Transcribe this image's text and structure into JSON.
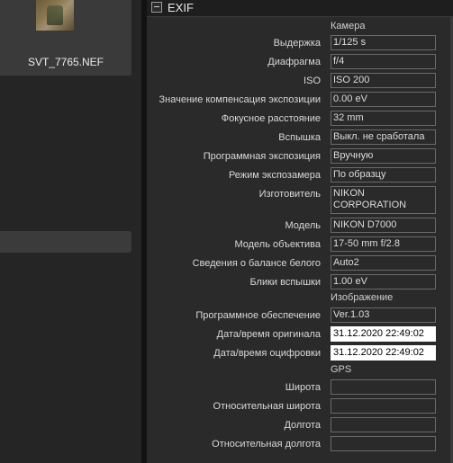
{
  "browser": {
    "thumbnail_name": "SVT_7765.NEF"
  },
  "panel": {
    "title": "EXIF",
    "sections": {
      "camera": "Камера",
      "image": "Изображение",
      "gps": "GPS"
    },
    "camera_rows": [
      {
        "label": "Выдержка",
        "value": "1/125 s"
      },
      {
        "label": "Диафрагма",
        "value": "f/4"
      },
      {
        "label": "ISO",
        "value": "ISO 200"
      },
      {
        "label": "Значение компенсация экспозиции",
        "value": "0.00 eV"
      },
      {
        "label": "Фокусное расстояние",
        "value": "32 mm"
      },
      {
        "label": "Вспышка",
        "value": "Выкл. не сработала"
      },
      {
        "label": "Программная экспозиция",
        "value": "Вручную"
      },
      {
        "label": "Режим экспозамера",
        "value": "По образцу"
      },
      {
        "label": "Изготовитель",
        "value": "NIKON\nCORPORATION"
      },
      {
        "label": "Модель",
        "value": "NIKON D7000"
      },
      {
        "label": "Модель объектива",
        "value": "17-50 mm f/2.8"
      },
      {
        "label": "Сведения о балансе белого",
        "value": "Auto2"
      },
      {
        "label": "Блики вспышки",
        "value": "1.00 eV"
      }
    ],
    "image_rows": [
      {
        "label": "Программное обеспечение",
        "value": "Ver.1.03"
      },
      {
        "label": "Дата/время оригинала",
        "value": "31.12.2020 22:49:02"
      },
      {
        "label": "Дата/время оцифровки",
        "value": "31.12.2020 22:49:02"
      }
    ],
    "gps_rows": [
      {
        "label": "Широта",
        "value": ""
      },
      {
        "label": "Относительная широта",
        "value": ""
      },
      {
        "label": "Долгота",
        "value": ""
      },
      {
        "label": "Относительная долгота",
        "value": ""
      }
    ]
  }
}
